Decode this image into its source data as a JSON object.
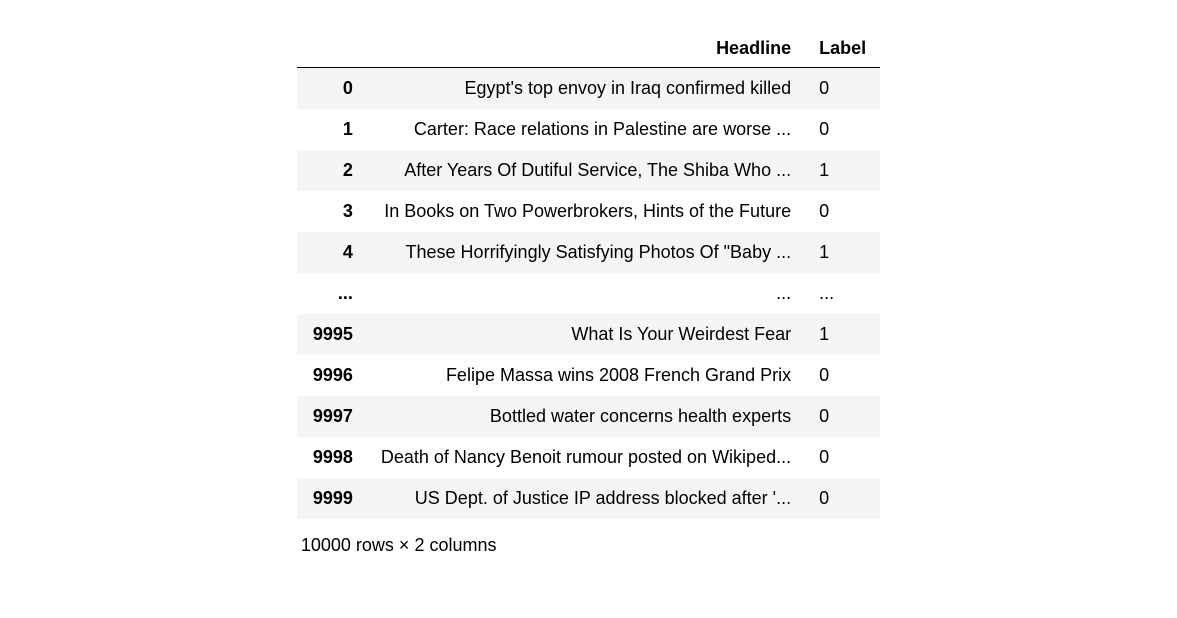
{
  "table": {
    "columns": [
      "Headline",
      "Label"
    ],
    "index_name": "",
    "rows": [
      {
        "index": "0",
        "headline": "Egypt's top envoy in Iraq confirmed killed",
        "label": "0"
      },
      {
        "index": "1",
        "headline": "Carter: Race relations in Palestine are worse ...",
        "label": "0"
      },
      {
        "index": "2",
        "headline": "After Years Of Dutiful Service, The Shiba Who ...",
        "label": "1"
      },
      {
        "index": "3",
        "headline": "In Books on Two Powerbrokers, Hints of the Future",
        "label": "0"
      },
      {
        "index": "4",
        "headline": "These Horrifyingly Satisfying Photos Of \"Baby ...",
        "label": "1"
      },
      {
        "index": "...",
        "headline": "...",
        "label": "..."
      },
      {
        "index": "9995",
        "headline": "What Is Your Weirdest Fear",
        "label": "1"
      },
      {
        "index": "9996",
        "headline": "Felipe Massa wins 2008 French Grand Prix",
        "label": "0"
      },
      {
        "index": "9997",
        "headline": "Bottled water concerns health experts",
        "label": "0"
      },
      {
        "index": "9998",
        "headline": "Death of Nancy Benoit rumour posted on Wikiped...",
        "label": "0"
      },
      {
        "index": "9999",
        "headline": "US Dept. of Justice IP address blocked after '...",
        "label": "0"
      }
    ],
    "shape_text": "10000 rows × 2 columns"
  }
}
